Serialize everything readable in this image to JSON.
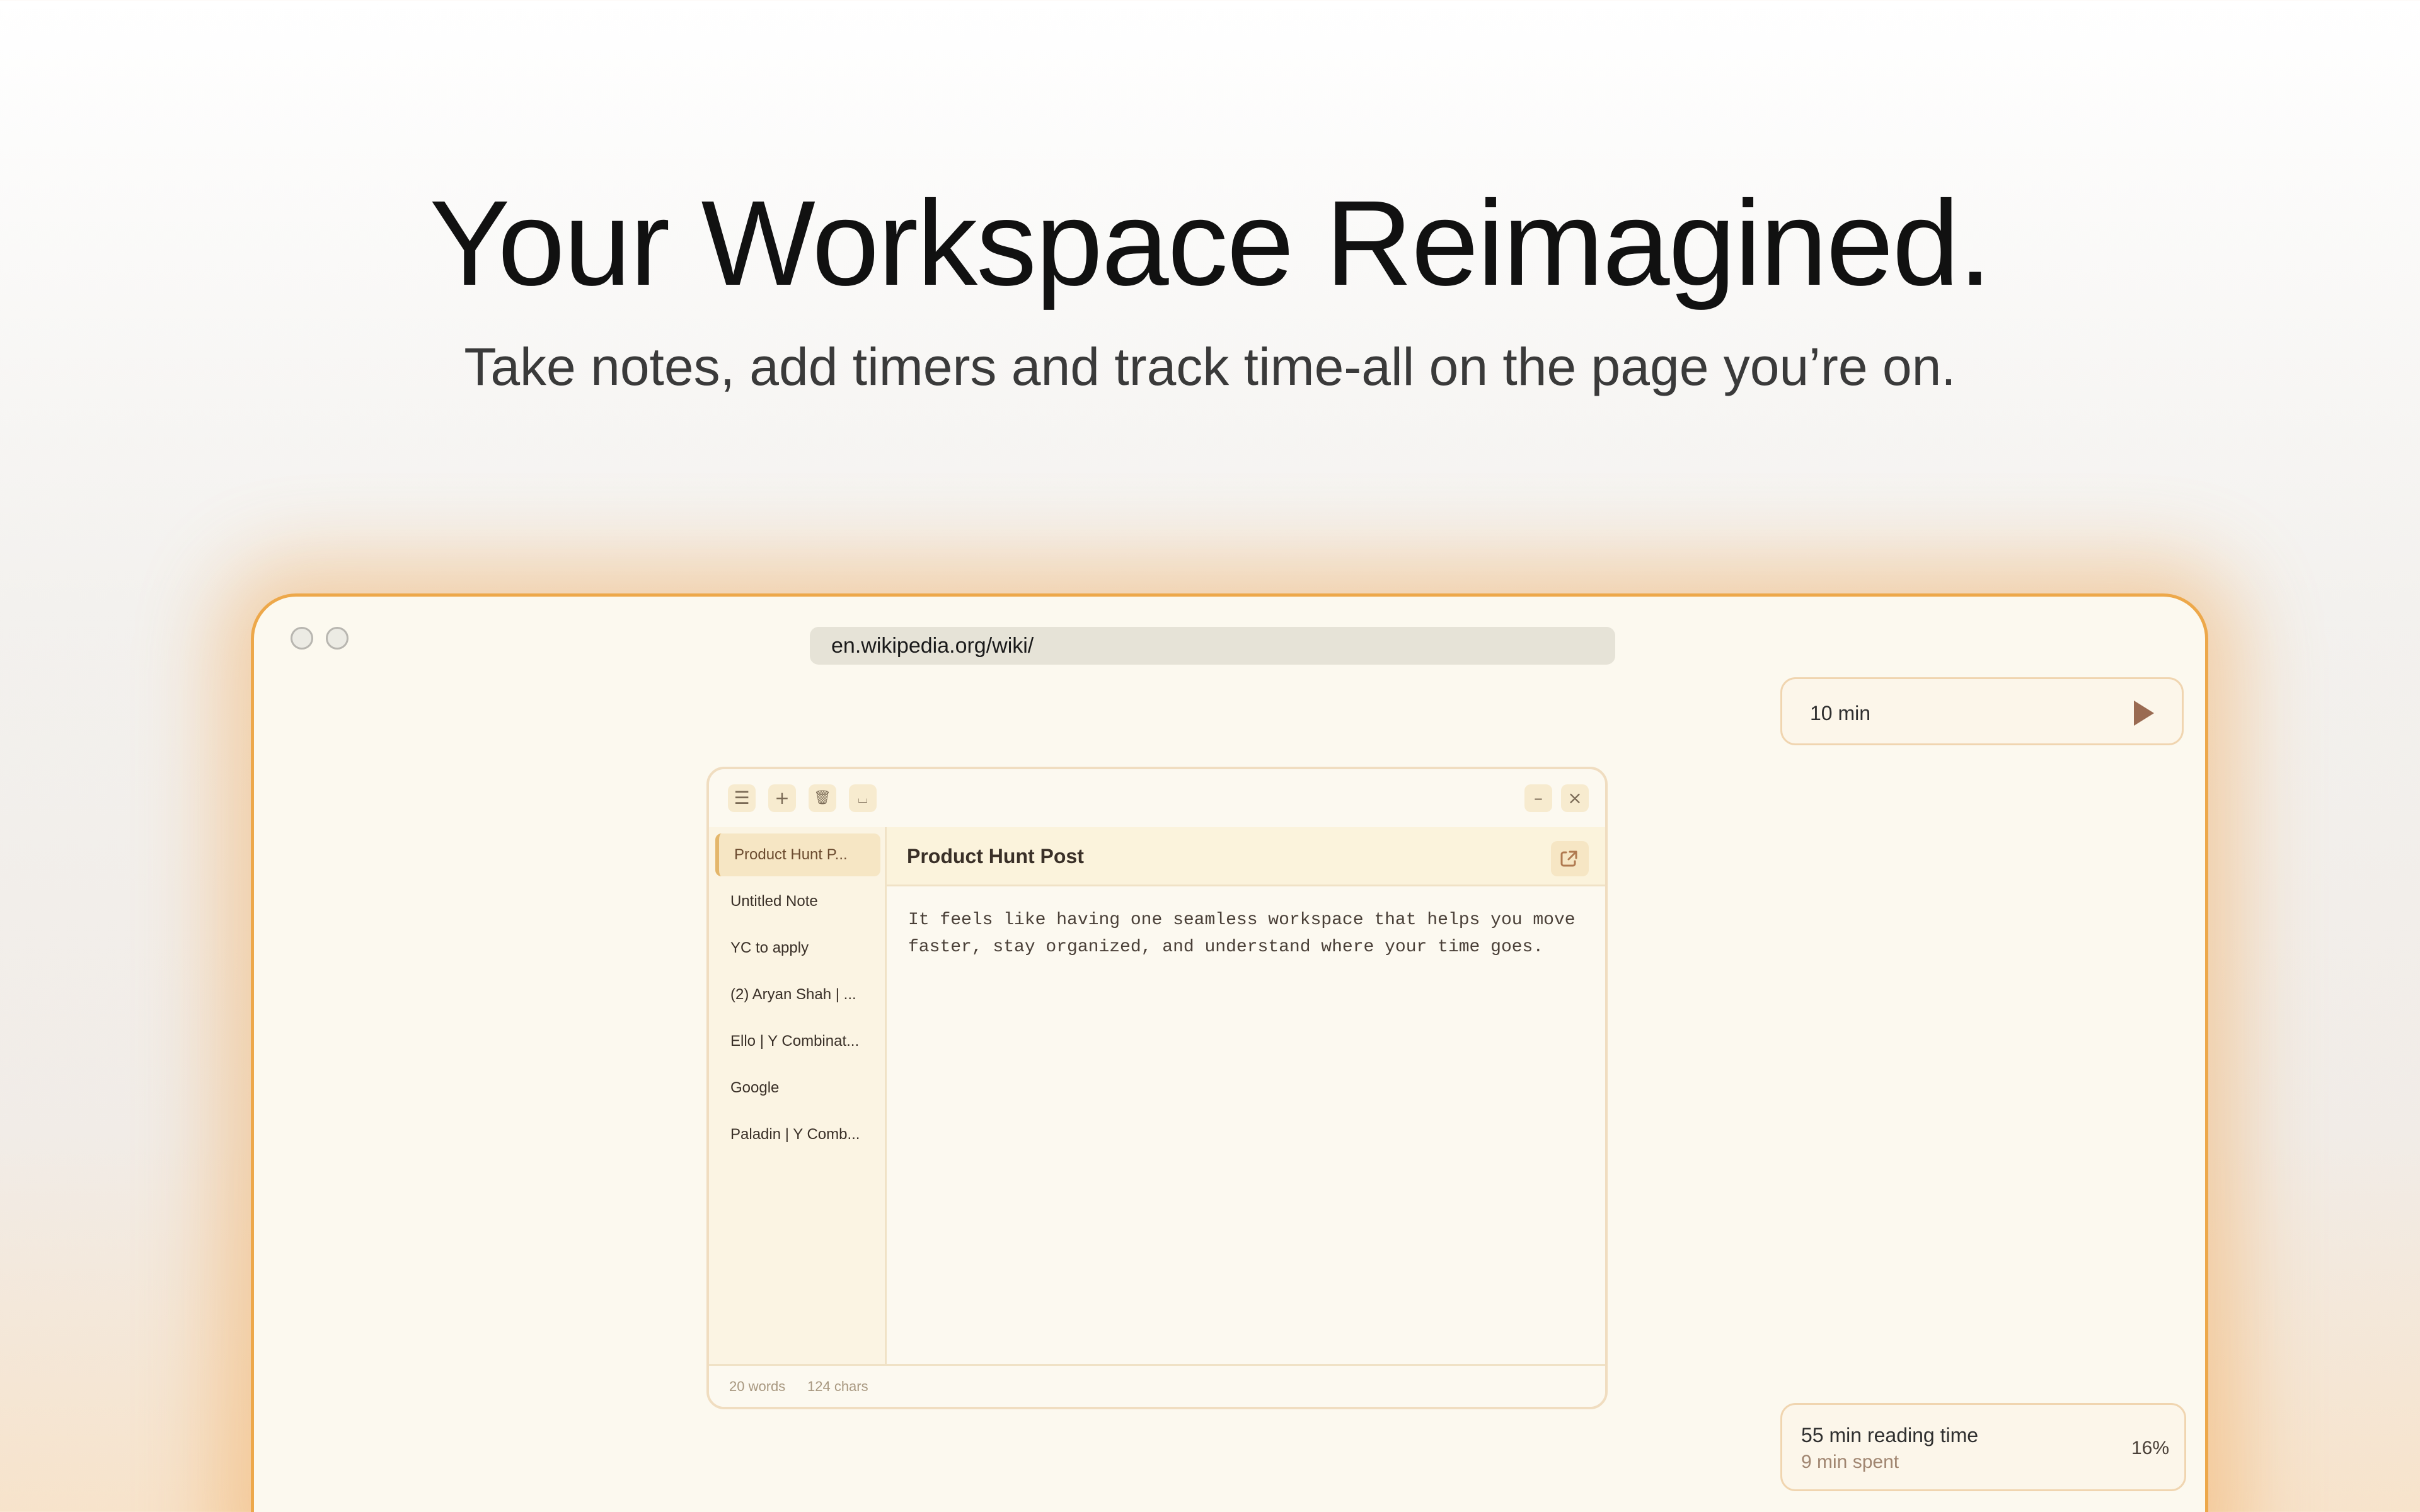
{
  "hero": {
    "title": "Your Workspace Reimagined.",
    "subtitle": "Take notes, add timers and track time-all on the page you’re on."
  },
  "browser": {
    "url": "en.wikipedia.org/wiki/"
  },
  "timer": {
    "label": "10 min",
    "play_icon": "play-icon"
  },
  "notes": {
    "toolbar": {
      "menu_icon": "☰",
      "add_icon": "+",
      "delete_icon": "🗑",
      "blank_icon": "⌴",
      "minimize_icon": "–",
      "close_icon": "×"
    },
    "sidebar": {
      "items": [
        {
          "label": "Product Hunt P..."
        },
        {
          "label": "Untitled Note"
        },
        {
          "label": "YC to apply"
        },
        {
          "label": "(2) Aryan Shah | ..."
        },
        {
          "label": "Ello | Y Combinat..."
        },
        {
          "label": "Google"
        },
        {
          "label": "Paladin | Y Comb..."
        }
      ]
    },
    "editor": {
      "title": "Product Hunt Post",
      "body": "It feels like having one seamless workspace that helps you move faster, stay organized, and understand where your time goes."
    },
    "footer": {
      "words": "20 words",
      "chars": "124 chars"
    }
  },
  "reading": {
    "time": "55 min reading time",
    "spent": "9 min spent",
    "percent": "16%"
  },
  "colors": {
    "accent": "#eda84a",
    "panel_bg": "#fcf9ef",
    "active_item": "#f6e6c4"
  }
}
